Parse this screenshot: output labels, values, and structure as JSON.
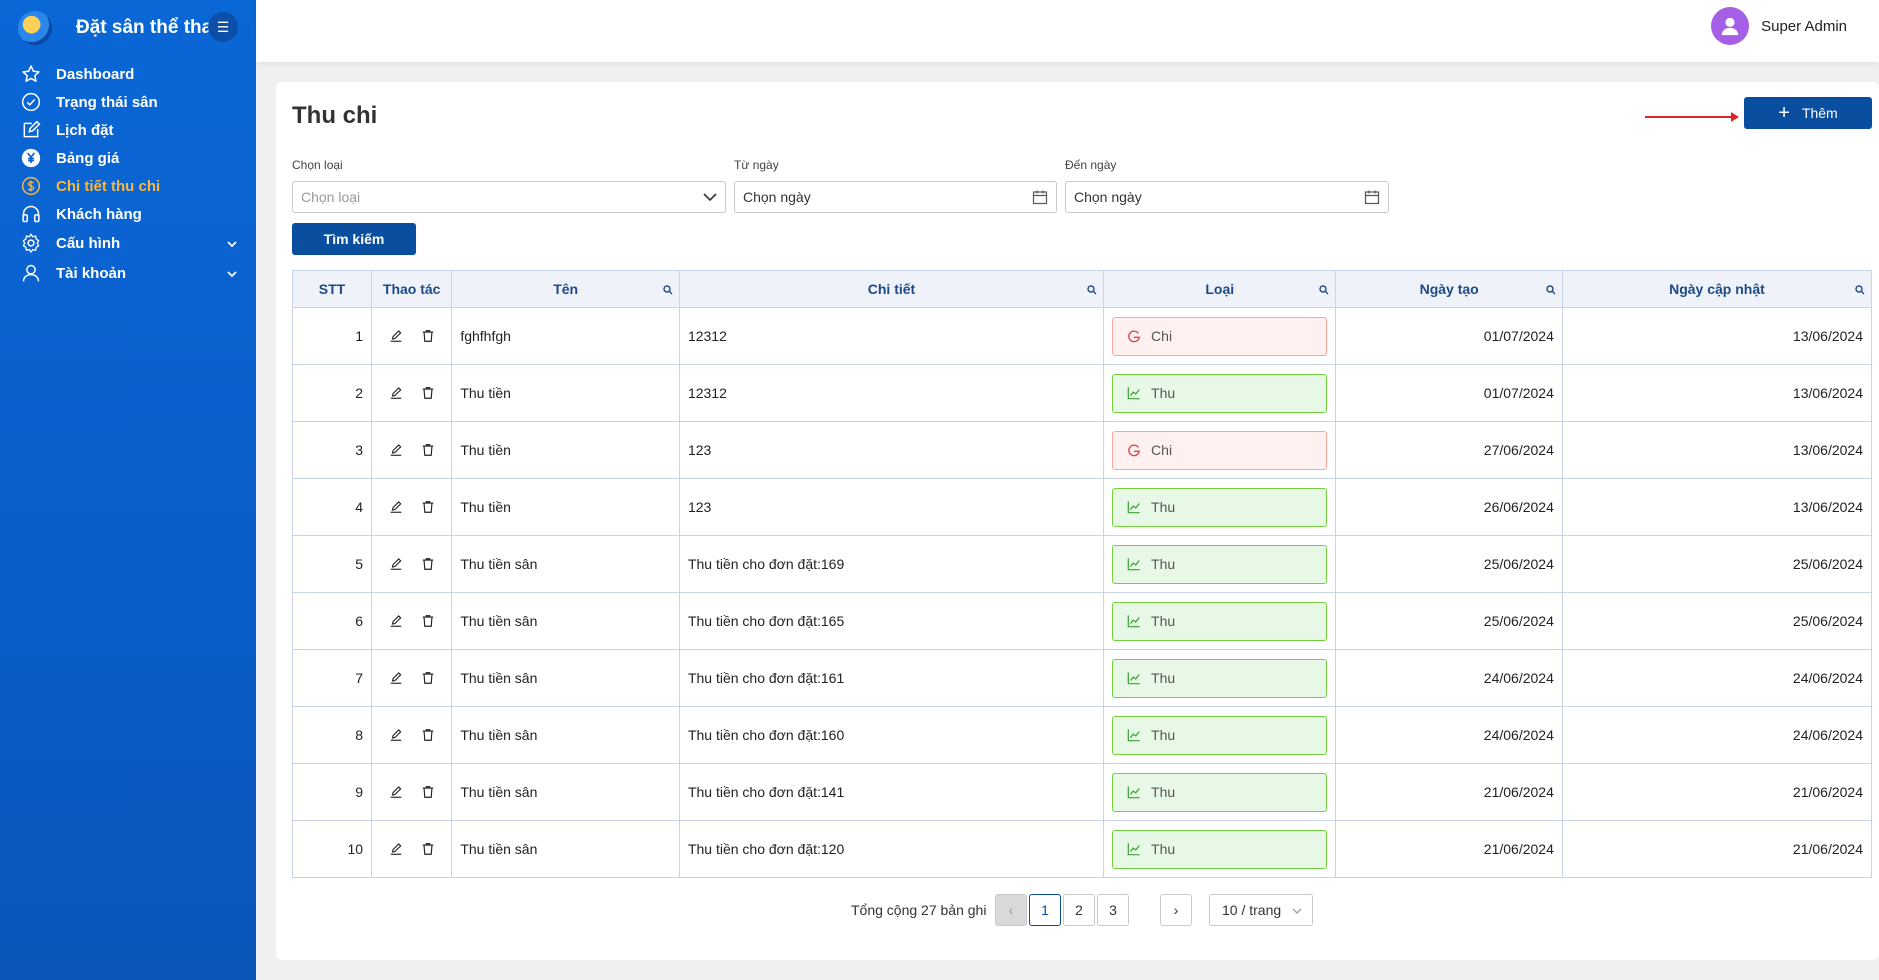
{
  "app": {
    "brand_title": "Đặt sân thể thao",
    "menu_icon": "menu-fold-icon"
  },
  "sidebar": {
    "items": [
      {
        "label": "Dashboard",
        "icon": "star-icon",
        "active": false
      },
      {
        "label": "Trạng thái sân",
        "icon": "check-circle-icon",
        "active": false
      },
      {
        "label": "Lịch đặt",
        "icon": "edit-icon",
        "active": false
      },
      {
        "label": "Bảng giá",
        "icon": "yen-icon",
        "active": false
      },
      {
        "label": "Chi tiết thu chi",
        "icon": "dollar-icon",
        "active": true
      },
      {
        "label": "Khách hàng",
        "icon": "headphones-icon",
        "active": false
      },
      {
        "label": "Cấu hình",
        "icon": "gear-icon",
        "active": false,
        "expandable": true
      },
      {
        "label": "Tài khoản",
        "icon": "user-icon",
        "active": false,
        "expandable": true
      }
    ]
  },
  "header": {
    "user_name": "Super Admin"
  },
  "page": {
    "title": "Thu chi",
    "add_label": "Thêm",
    "filters": {
      "type_label": "Chọn loại",
      "type_placeholder": "Chọn loại",
      "from_label": "Từ ngày",
      "from_value": "Chọn ngày",
      "to_label": "Đến ngày",
      "to_value": "Chọn ngày"
    },
    "search_label": "Tìm kiếm"
  },
  "table": {
    "columns": [
      "STT",
      "Thao tác",
      "Tên",
      "Chi tiết",
      "Loại",
      "Ngày tạo",
      "Ngày cập nhật"
    ],
    "rows": [
      {
        "stt": "1",
        "ten": "fghfhfgh",
        "chi_tiet": "12312",
        "loai": "Chi",
        "ngay_tao": "01/07/2024",
        "ngay_cap_nhat": "13/06/2024"
      },
      {
        "stt": "2",
        "ten": "Thu tiền",
        "chi_tiet": "12312",
        "loai": "Thu",
        "ngay_tao": "01/07/2024",
        "ngay_cap_nhat": "13/06/2024"
      },
      {
        "stt": "3",
        "ten": "Thu tiền",
        "chi_tiet": "123",
        "loai": "Chi",
        "ngay_tao": "27/06/2024",
        "ngay_cap_nhat": "13/06/2024"
      },
      {
        "stt": "4",
        "ten": "Thu tiền",
        "chi_tiet": "123",
        "loai": "Thu",
        "ngay_tao": "26/06/2024",
        "ngay_cap_nhat": "13/06/2024"
      },
      {
        "stt": "5",
        "ten": "Thu tiền sân",
        "chi_tiet": "Thu tiền cho đơn đặt:169",
        "loai": "Thu",
        "ngay_tao": "25/06/2024",
        "ngay_cap_nhat": "25/06/2024"
      },
      {
        "stt": "6",
        "ten": "Thu tiền sân",
        "chi_tiet": "Thu tiền cho đơn đặt:165",
        "loai": "Thu",
        "ngay_tao": "25/06/2024",
        "ngay_cap_nhat": "25/06/2024"
      },
      {
        "stt": "7",
        "ten": "Thu tiền sân",
        "chi_tiet": "Thu tiền cho đơn đặt:161",
        "loai": "Thu",
        "ngay_tao": "24/06/2024",
        "ngay_cap_nhat": "24/06/2024"
      },
      {
        "stt": "8",
        "ten": "Thu tiền sân",
        "chi_tiet": "Thu tiền cho đơn đặt:160",
        "loai": "Thu",
        "ngay_tao": "24/06/2024",
        "ngay_cap_nhat": "24/06/2024"
      },
      {
        "stt": "9",
        "ten": "Thu tiền sân",
        "chi_tiet": "Thu tiền cho đơn đặt:141",
        "loai": "Thu",
        "ngay_tao": "21/06/2024",
        "ngay_cap_nhat": "21/06/2024"
      },
      {
        "stt": "10",
        "ten": "Thu tiền sân",
        "chi_tiet": "Thu tiền cho đơn đặt:120",
        "loai": "Thu",
        "ngay_tao": "21/06/2024",
        "ngay_cap_nhat": "21/06/2024"
      }
    ]
  },
  "pagination": {
    "total_text": "Tổng cộng 27 bản ghi",
    "pages": [
      "1",
      "2",
      "3"
    ],
    "current": "1",
    "page_size": "10 / trang"
  },
  "colors": {
    "sidebar": "#0a5fcc",
    "primary": "#0a4ea0",
    "active_menu": "#f5b942",
    "chi_badge": "#fff1f0",
    "thu_badge": "#e8f8e6",
    "annotation_arrow": "#d9262c"
  }
}
